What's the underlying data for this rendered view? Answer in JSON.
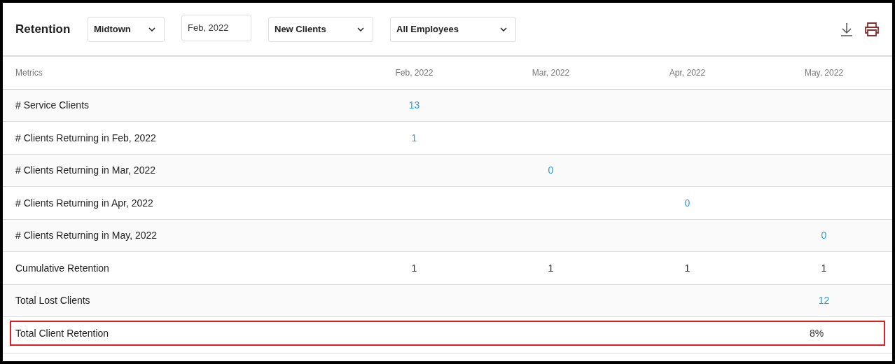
{
  "title": "Retention",
  "filters": [
    {
      "kind": "select",
      "value": "Midtown"
    },
    {
      "kind": "date",
      "value": "Feb, 2022"
    },
    {
      "kind": "select",
      "value": "New Clients"
    },
    {
      "kind": "select",
      "value": "All Employees"
    }
  ],
  "table": {
    "columns": [
      "Metrics",
      "Feb, 2022",
      "Mar, 2022",
      "Apr, 2022",
      "May, 2022"
    ],
    "rows": [
      {
        "highlighted": false,
        "cells": [
          {
            "text": "# Service Clients",
            "kind": "label"
          },
          {
            "text": "13",
            "kind": "link"
          },
          {
            "text": "",
            "kind": "plain"
          },
          {
            "text": "",
            "kind": "plain"
          },
          {
            "text": "",
            "kind": "plain"
          }
        ]
      },
      {
        "highlighted": false,
        "cells": [
          {
            "text": "# Clients Returning in Feb, 2022",
            "kind": "label"
          },
          {
            "text": "1",
            "kind": "link"
          },
          {
            "text": "",
            "kind": "plain"
          },
          {
            "text": "",
            "kind": "plain"
          },
          {
            "text": "",
            "kind": "plain"
          }
        ]
      },
      {
        "highlighted": false,
        "cells": [
          {
            "text": "# Clients Returning in Mar, 2022",
            "kind": "label"
          },
          {
            "text": "",
            "kind": "plain"
          },
          {
            "text": "0",
            "kind": "link"
          },
          {
            "text": "",
            "kind": "plain"
          },
          {
            "text": "",
            "kind": "plain"
          }
        ]
      },
      {
        "highlighted": false,
        "cells": [
          {
            "text": "# Clients Returning in Apr, 2022",
            "kind": "label"
          },
          {
            "text": "",
            "kind": "plain"
          },
          {
            "text": "",
            "kind": "plain"
          },
          {
            "text": "0",
            "kind": "link"
          },
          {
            "text": "",
            "kind": "plain"
          }
        ]
      },
      {
        "highlighted": false,
        "cells": [
          {
            "text": "# Clients Returning in May, 2022",
            "kind": "label"
          },
          {
            "text": "",
            "kind": "plain"
          },
          {
            "text": "",
            "kind": "plain"
          },
          {
            "text": "",
            "kind": "plain"
          },
          {
            "text": "0",
            "kind": "link"
          }
        ]
      },
      {
        "highlighted": false,
        "cells": [
          {
            "text": "Cumulative Retention",
            "kind": "label"
          },
          {
            "text": "1",
            "kind": "plain"
          },
          {
            "text": "1",
            "kind": "plain"
          },
          {
            "text": "1",
            "kind": "plain"
          },
          {
            "text": "1",
            "kind": "plain"
          }
        ]
      },
      {
        "highlighted": false,
        "cells": [
          {
            "text": "Total Lost Clients",
            "kind": "label"
          },
          {
            "text": "",
            "kind": "plain"
          },
          {
            "text": "",
            "kind": "plain"
          },
          {
            "text": "",
            "kind": "plain"
          },
          {
            "text": "12",
            "kind": "link"
          }
        ]
      },
      {
        "highlighted": true,
        "cells": [
          {
            "text": "Total Client Retention",
            "kind": "label"
          },
          {
            "text": "",
            "kind": "plain"
          },
          {
            "text": "",
            "kind": "plain"
          },
          {
            "text": "",
            "kind": "plain"
          },
          {
            "text": "8%",
            "kind": "plain"
          }
        ]
      }
    ]
  }
}
